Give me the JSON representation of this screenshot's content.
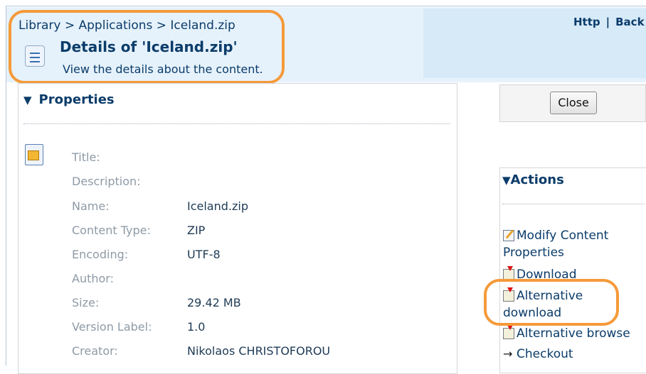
{
  "breadcrumb": [
    "Library",
    "Applications",
    "Iceland.zip"
  ],
  "breadcrumb_sep": ">",
  "header": {
    "title": "Details of 'Iceland.zip'",
    "subtitle": "View the details about the content.",
    "links": [
      "Http",
      "Back"
    ]
  },
  "properties": {
    "section_title": "Properties",
    "rows": [
      {
        "label": "Title:",
        "value": ""
      },
      {
        "label": "Description:",
        "value": ""
      },
      {
        "label": "Name:",
        "value": "Iceland.zip"
      },
      {
        "label": "Content Type:",
        "value": "ZIP"
      },
      {
        "label": "Encoding:",
        "value": "UTF-8"
      },
      {
        "label": "Author:",
        "value": ""
      },
      {
        "label": "Size:",
        "value": "29.42 MB"
      },
      {
        "label": "Version Label:",
        "value": "1.0"
      },
      {
        "label": "Creator:",
        "value": "Nikolaos CHRISTOFOROU"
      }
    ]
  },
  "close_label": "Close",
  "actions": {
    "section_title": "Actions",
    "items": [
      {
        "line1": "Modify Content",
        "line2": "Properties",
        "icon": "edit-icon"
      },
      {
        "line1": "Download",
        "icon": "download-icon"
      },
      {
        "line1": "Alternative",
        "line2": "download",
        "icon": "download-icon"
      },
      {
        "line1": "Alternative browse",
        "icon": "download-icon"
      },
      {
        "line1": "Checkout",
        "icon": "arrow-icon"
      }
    ]
  },
  "colors": {
    "highlight": "#f59a3a",
    "link": "#0b3c6a",
    "header_bg": "#e6f2fb"
  }
}
